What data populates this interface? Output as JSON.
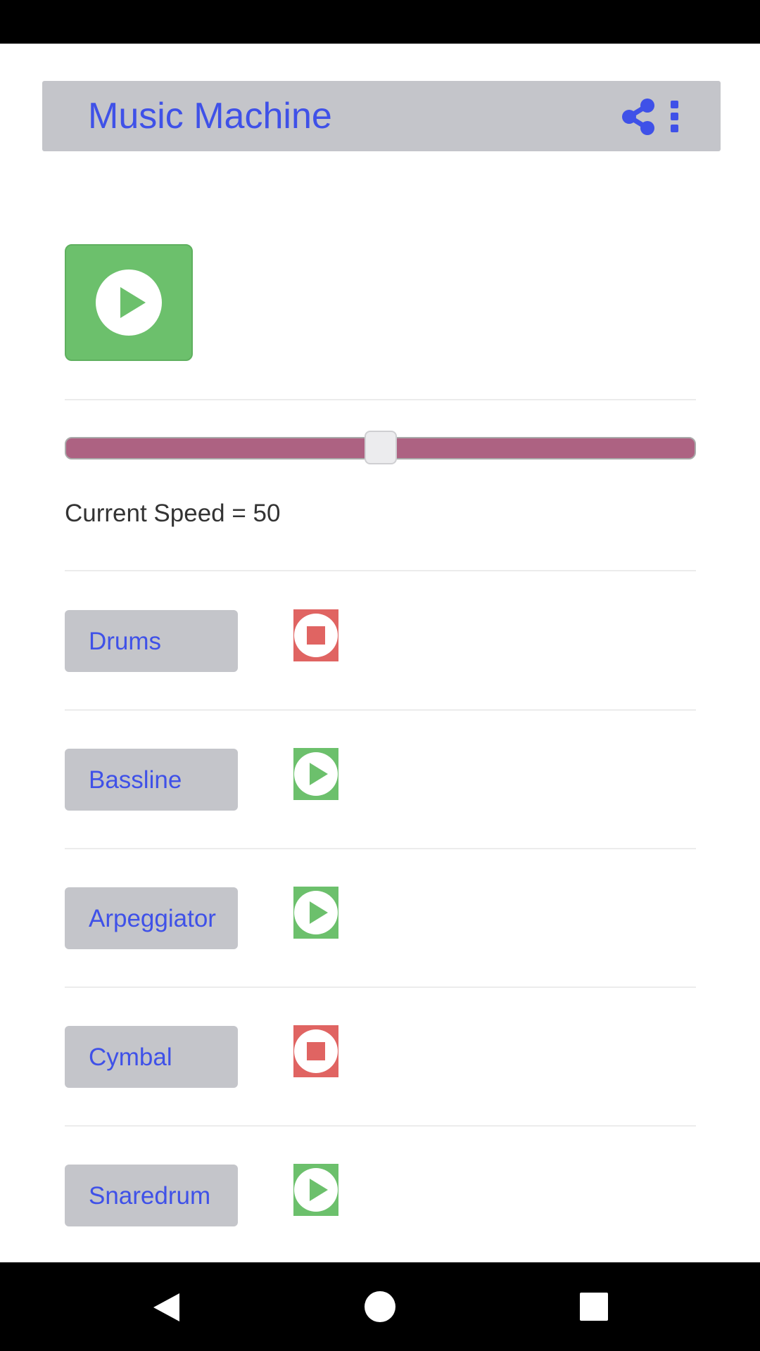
{
  "app": {
    "title": "Music Machine",
    "share_icon": "share-icon",
    "more_icon": "more-vert-icon"
  },
  "player": {
    "main_toggle_state": "stopped",
    "main_icon": "play-circle-icon"
  },
  "speed": {
    "value": 50,
    "min": 0,
    "max": 100,
    "label": "Current Speed = 50"
  },
  "tracks": [
    {
      "label": "Drums",
      "state": "playing",
      "icon": "stop-circle-icon"
    },
    {
      "label": "Bassline",
      "state": "stopped",
      "icon": "play-circle-icon"
    },
    {
      "label": "Arpeggiator",
      "state": "stopped",
      "icon": "play-circle-icon"
    },
    {
      "label": "Cymbal",
      "state": "playing",
      "icon": "stop-circle-icon"
    },
    {
      "label": "Snaredrum",
      "state": "stopped",
      "icon": "play-circle-icon"
    }
  ],
  "nav": {
    "back_icon": "back-triangle-icon",
    "home_icon": "home-circle-icon",
    "recents_icon": "recents-square-icon"
  },
  "colors": {
    "accent": "#3f51e8",
    "toolbar_bg": "#c4c5ca",
    "play_green": "#6cc06c",
    "stop_red": "#e06462",
    "slider_track": "#ad6282"
  }
}
